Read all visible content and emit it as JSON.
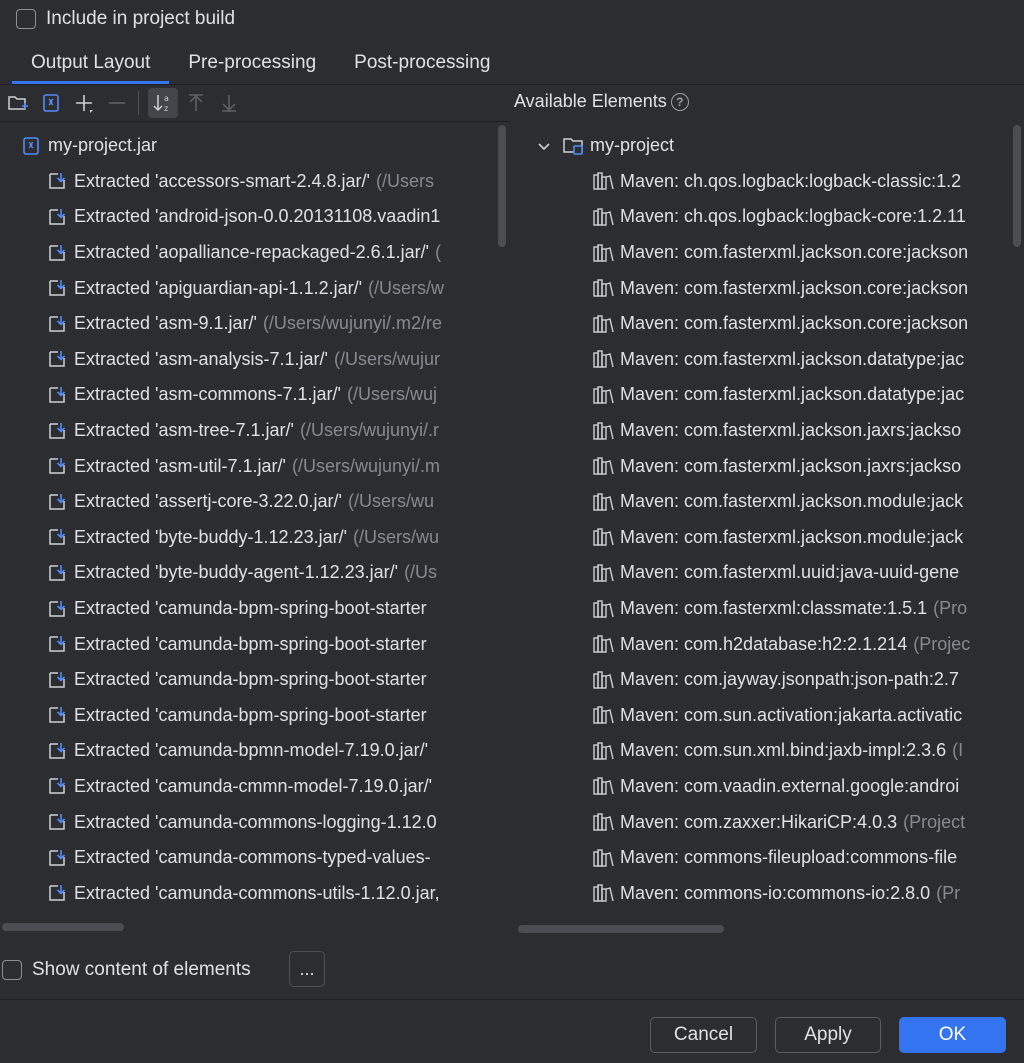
{
  "top_checkbox": {
    "label": "Include in project build",
    "checked": false
  },
  "tabs": [
    {
      "label": "Output Layout",
      "active": true
    },
    {
      "label": "Pre-processing",
      "active": false
    },
    {
      "label": "Post-processing",
      "active": false
    }
  ],
  "toolbar": {
    "icons": [
      "new-folder-icon",
      "archive-icon",
      "add-icon",
      "remove-icon",
      "sort-alpha-icon",
      "move-up-icon",
      "move-down-icon"
    ]
  },
  "left_tree": {
    "root": {
      "label": "my-project.jar",
      "icon": "jar-archive-icon"
    },
    "items": [
      {
        "label": "Extracted 'accessors-smart-2.4.8.jar/'",
        "path": "(/Users"
      },
      {
        "label": "Extracted 'android-json-0.0.20131108.vaadin1",
        "path": ""
      },
      {
        "label": "Extracted 'aopalliance-repackaged-2.6.1.jar/'",
        "path": "("
      },
      {
        "label": "Extracted 'apiguardian-api-1.1.2.jar/'",
        "path": "(/Users/w"
      },
      {
        "label": "Extracted 'asm-9.1.jar/'",
        "path": "(/Users/wujunyi/.m2/re"
      },
      {
        "label": "Extracted 'asm-analysis-7.1.jar/'",
        "path": "(/Users/wujur"
      },
      {
        "label": "Extracted 'asm-commons-7.1.jar/'",
        "path": "(/Users/wuj"
      },
      {
        "label": "Extracted 'asm-tree-7.1.jar/'",
        "path": "(/Users/wujunyi/.r"
      },
      {
        "label": "Extracted 'asm-util-7.1.jar/'",
        "path": "(/Users/wujunyi/.m"
      },
      {
        "label": "Extracted 'assertj-core-3.22.0.jar/'",
        "path": "(/Users/wu"
      },
      {
        "label": "Extracted 'byte-buddy-1.12.23.jar/'",
        "path": "(/Users/wu"
      },
      {
        "label": "Extracted 'byte-buddy-agent-1.12.23.jar/'",
        "path": "(/Us"
      },
      {
        "label": "Extracted 'camunda-bpm-spring-boot-starter",
        "path": ""
      },
      {
        "label": "Extracted 'camunda-bpm-spring-boot-starter",
        "path": ""
      },
      {
        "label": "Extracted 'camunda-bpm-spring-boot-starter",
        "path": ""
      },
      {
        "label": "Extracted 'camunda-bpm-spring-boot-starter",
        "path": ""
      },
      {
        "label": "Extracted 'camunda-bpmn-model-7.19.0.jar/'",
        "path": ""
      },
      {
        "label": "Extracted 'camunda-cmmn-model-7.19.0.jar/'",
        "path": ""
      },
      {
        "label": "Extracted 'camunda-commons-logging-1.12.0",
        "path": ""
      },
      {
        "label": "Extracted 'camunda-commons-typed-values-",
        "path": ""
      },
      {
        "label": "Extracted 'camunda-commons-utils-1.12.0.jar,",
        "path": ""
      }
    ]
  },
  "right_panel": {
    "header": "Available Elements",
    "help": "?",
    "root": {
      "label": "my-project",
      "expanded": true
    },
    "items": [
      {
        "label": "Maven: ch.qos.logback:logback-classic:1.2",
        "path": ""
      },
      {
        "label": "Maven: ch.qos.logback:logback-core:1.2.11",
        "path": ""
      },
      {
        "label": "Maven: com.fasterxml.jackson.core:jackson",
        "path": ""
      },
      {
        "label": "Maven: com.fasterxml.jackson.core:jackson",
        "path": ""
      },
      {
        "label": "Maven: com.fasterxml.jackson.core:jackson",
        "path": ""
      },
      {
        "label": "Maven: com.fasterxml.jackson.datatype:jac",
        "path": ""
      },
      {
        "label": "Maven: com.fasterxml.jackson.datatype:jac",
        "path": ""
      },
      {
        "label": "Maven: com.fasterxml.jackson.jaxrs:jackso",
        "path": ""
      },
      {
        "label": "Maven: com.fasterxml.jackson.jaxrs:jackso",
        "path": ""
      },
      {
        "label": "Maven: com.fasterxml.jackson.module:jack",
        "path": ""
      },
      {
        "label": "Maven: com.fasterxml.jackson.module:jack",
        "path": ""
      },
      {
        "label": "Maven: com.fasterxml.uuid:java-uuid-gene",
        "path": ""
      },
      {
        "label": "Maven: com.fasterxml:classmate:1.5.1",
        "path": "(Pro"
      },
      {
        "label": "Maven: com.h2database:h2:2.1.214",
        "path": "(Projec"
      },
      {
        "label": "Maven: com.jayway.jsonpath:json-path:2.7",
        "path": ""
      },
      {
        "label": "Maven: com.sun.activation:jakarta.activatic",
        "path": ""
      },
      {
        "label": "Maven: com.sun.xml.bind:jaxb-impl:2.3.6",
        "path": "(I"
      },
      {
        "label": "Maven: com.vaadin.external.google:androi",
        "path": ""
      },
      {
        "label": "Maven: com.zaxxer:HikariCP:4.0.3",
        "path": "(Project"
      },
      {
        "label": "Maven: commons-fileupload:commons-file",
        "path": ""
      },
      {
        "label": "Maven: commons-io:commons-io:2.8.0",
        "path": "(Pr"
      }
    ]
  },
  "bottom": {
    "show_content_label": "Show content of elements",
    "dots_label": "...",
    "cancel": "Cancel",
    "apply": "Apply",
    "ok": "OK"
  },
  "colors": {
    "background": "#2b2d30",
    "accent": "#3574f0",
    "text": "#dfe1e5",
    "muted": "#868a91"
  }
}
